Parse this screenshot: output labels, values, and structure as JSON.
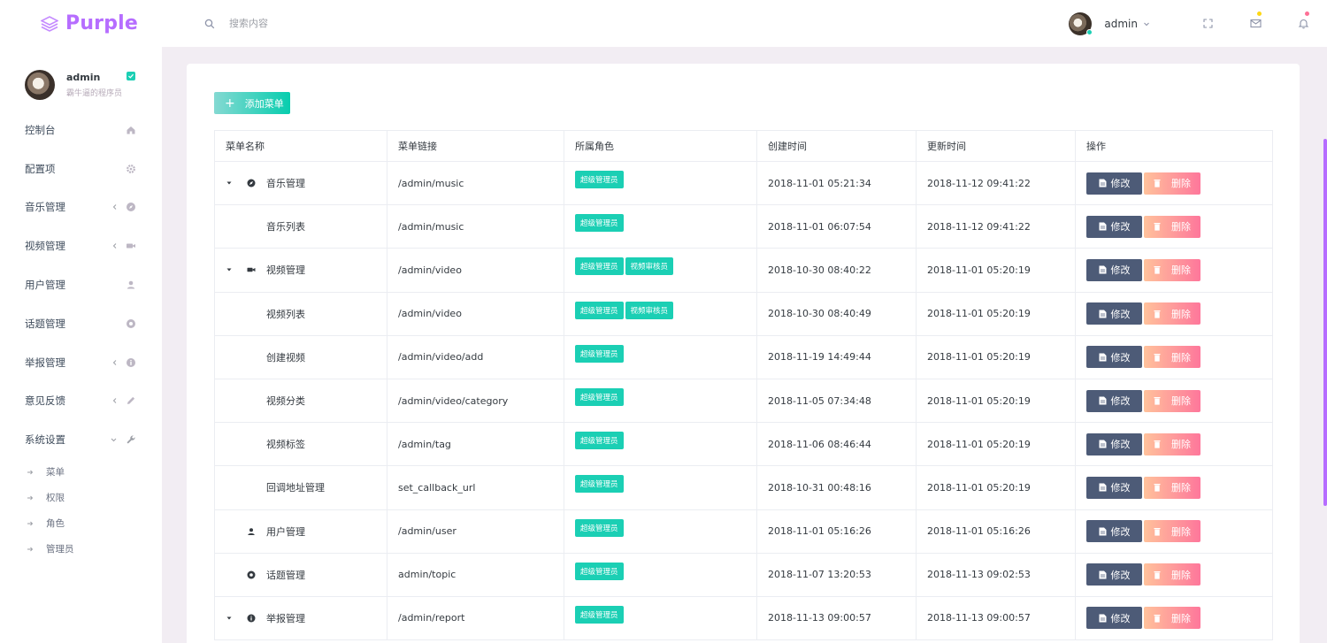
{
  "brand": {
    "name": "Purple",
    "color": "#b66dff"
  },
  "search": {
    "placeholder": "搜索内容"
  },
  "nav": {
    "username": "admin",
    "icons": [
      "fullscreen-icon",
      "mail-icon",
      "bell-icon"
    ],
    "mail_badge_color": "#fed713",
    "bell_badge_color": "#fe7096"
  },
  "profile": {
    "name": "admin",
    "subtitle": "霸牛逼的程序员"
  },
  "sidebar": {
    "items": [
      {
        "label": "控制台",
        "icon": "home-icon"
      },
      {
        "label": "配置项",
        "icon": "gear-icon"
      },
      {
        "label": "音乐管理",
        "icon": "compass-icon",
        "expandable": true
      },
      {
        "label": "视频管理",
        "icon": "video-icon",
        "expandable": true
      },
      {
        "label": "用户管理",
        "icon": "user-icon"
      },
      {
        "label": "话题管理",
        "icon": "topic-icon"
      },
      {
        "label": "举报管理",
        "icon": "info-icon",
        "expandable": true
      },
      {
        "label": "意见反馈",
        "icon": "pencil-icon",
        "expandable": true
      },
      {
        "label": "系统设置",
        "icon": "wrench-icon",
        "expanded": true
      }
    ],
    "subitems": [
      "菜单",
      "权限",
      "角色",
      "管理员"
    ]
  },
  "toolbar": {
    "add_label": "添加菜单"
  },
  "table": {
    "headers": [
      "菜单名称",
      "菜单链接",
      "所属角色",
      "创建时间",
      "更新时间",
      "操作"
    ],
    "edit_label": "修改",
    "delete_label": "删除",
    "rows": [
      {
        "name": "音乐管理",
        "link": "/admin/music",
        "roles": [
          "超级管理员"
        ],
        "created": "2018-11-01 05:21:34",
        "updated": "2018-11-12 09:41:22",
        "level": 0,
        "caret": true,
        "icon": "compass-icon"
      },
      {
        "name": "音乐列表",
        "link": "/admin/music",
        "roles": [
          "超级管理员"
        ],
        "created": "2018-11-01 06:07:54",
        "updated": "2018-11-12 09:41:22",
        "level": 1
      },
      {
        "name": "视频管理",
        "link": "/admin/video",
        "roles": [
          "超级管理员",
          "视频审核员"
        ],
        "created": "2018-10-30 08:40:22",
        "updated": "2018-11-01 05:20:19",
        "level": 0,
        "caret": true,
        "icon": "video-icon"
      },
      {
        "name": "视频列表",
        "link": "/admin/video",
        "roles": [
          "超级管理员",
          "视频审核员"
        ],
        "created": "2018-10-30 08:40:49",
        "updated": "2018-11-01 05:20:19",
        "level": 1
      },
      {
        "name": "创建视频",
        "link": "/admin/video/add",
        "roles": [
          "超级管理员"
        ],
        "created": "2018-11-19 14:49:44",
        "updated": "2018-11-01 05:20:19",
        "level": 1
      },
      {
        "name": "视频分类",
        "link": "/admin/video/category",
        "roles": [
          "超级管理员"
        ],
        "created": "2018-11-05 07:34:48",
        "updated": "2018-11-01 05:20:19",
        "level": 1
      },
      {
        "name": "视频标签",
        "link": "/admin/tag",
        "roles": [
          "超级管理员"
        ],
        "created": "2018-11-06 08:46:44",
        "updated": "2018-11-01 05:20:19",
        "level": 1
      },
      {
        "name": "回调地址管理",
        "link": "set_callback_url",
        "roles": [
          "超级管理员"
        ],
        "created": "2018-10-31 00:48:16",
        "updated": "2018-11-01 05:20:19",
        "level": 1
      },
      {
        "name": "用户管理",
        "link": "/admin/user",
        "roles": [
          "超级管理员"
        ],
        "created": "2018-11-01 05:16:26",
        "updated": "2018-11-01 05:16:26",
        "level": 0,
        "caret": false,
        "icon": "user-icon"
      },
      {
        "name": "话题管理",
        "link": "admin/topic",
        "roles": [
          "超级管理员"
        ],
        "created": "2018-11-07 13:20:53",
        "updated": "2018-11-13 09:02:53",
        "level": 0,
        "caret": false,
        "icon": "topic-icon"
      },
      {
        "name": "举报管理",
        "link": "/admin/report",
        "roles": [
          "超级管理员"
        ],
        "created": "2018-11-13 09:00:57",
        "updated": "2018-11-13 09:00:57",
        "level": 0,
        "caret": true,
        "icon": "info-icon"
      }
    ]
  },
  "colors": {
    "accent": "#b66dff",
    "success": "#1bcfb4",
    "edit_button": "#4d5b77",
    "delete_gradient": [
      "#ffbf96",
      "#fe7096"
    ],
    "add_gradient": [
      "#84d9d2",
      "#07cdae"
    ]
  }
}
